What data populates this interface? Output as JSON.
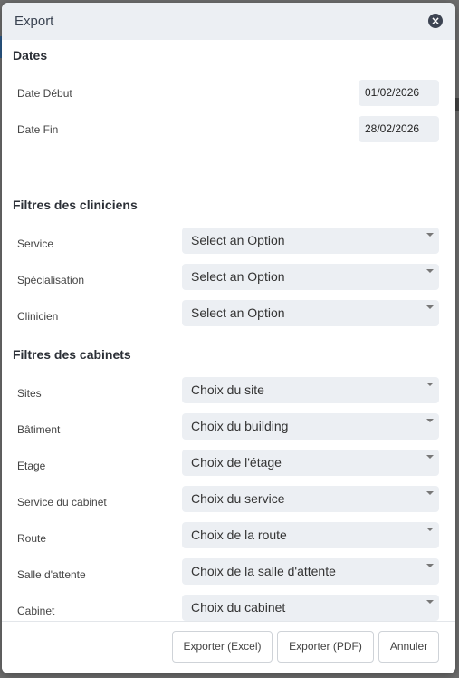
{
  "modal": {
    "title": "Export",
    "close_icon": "close-icon"
  },
  "dates": {
    "section_title": "Dates",
    "start": {
      "label": "Date Début",
      "value": "01/02/2026"
    },
    "end": {
      "label": "Date Fin",
      "value": "28/02/2026"
    }
  },
  "clinicians": {
    "section_title": "Filtres des cliniciens",
    "fields": [
      {
        "label": "Service",
        "value": "Select an Option"
      },
      {
        "label": "Spécialisation",
        "value": "Select an Option"
      },
      {
        "label": "Clinicien",
        "value": "Select an Option"
      }
    ]
  },
  "cabinets": {
    "section_title": "Filtres des cabinets",
    "fields": [
      {
        "label": "Sites",
        "value": "Choix du site"
      },
      {
        "label": "Bâtiment",
        "value": "Choix du building"
      },
      {
        "label": "Etage",
        "value": "Choix de l'étage"
      },
      {
        "label": "Service du cabinet",
        "value": "Choix du service"
      },
      {
        "label": "Route",
        "value": "Choix de la route"
      },
      {
        "label": "Salle d'attente",
        "value": "Choix de la salle d'attente"
      },
      {
        "label": "Cabinet",
        "value": "Choix du cabinet"
      }
    ]
  },
  "footer": {
    "export_excel": "Exporter (Excel)",
    "export_pdf": "Exporter (PDF)",
    "cancel": "Annuler"
  }
}
